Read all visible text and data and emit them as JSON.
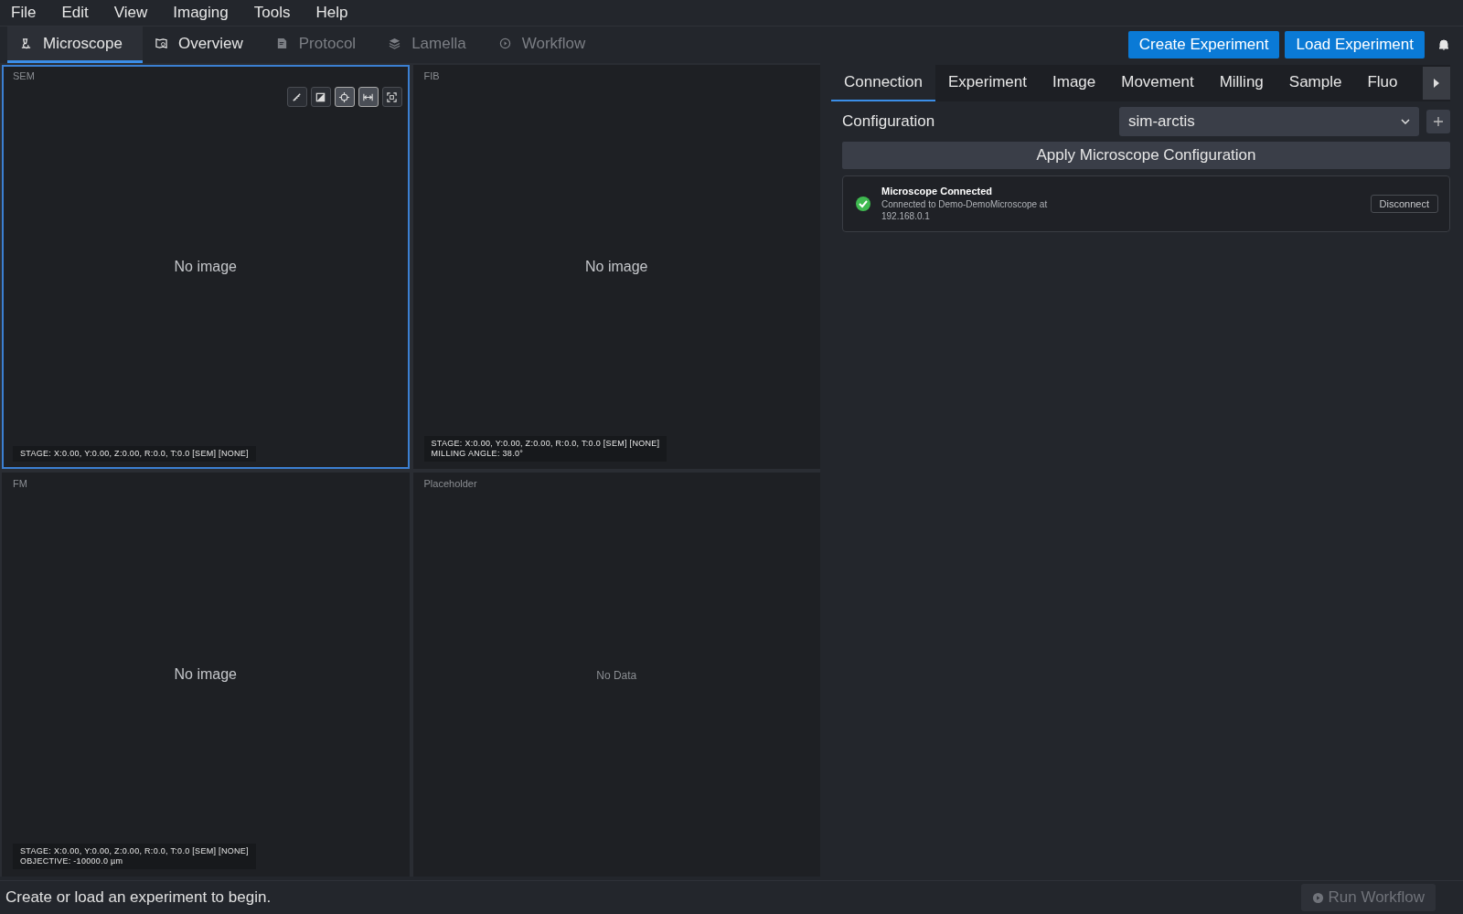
{
  "menu_bar": [
    "File",
    "Edit",
    "View",
    "Imaging",
    "Tools",
    "Help"
  ],
  "main_tabs": [
    {
      "label": "Microscope",
      "selected": true,
      "disabled": false
    },
    {
      "label": "Overview",
      "selected": false,
      "disabled": false
    },
    {
      "label": "Protocol",
      "selected": false,
      "disabled": true
    },
    {
      "label": "Lamella",
      "selected": false,
      "disabled": true
    },
    {
      "label": "Workflow",
      "selected": false,
      "disabled": true
    }
  ],
  "header_buttons": [
    "Create Experiment",
    "Load Experiment"
  ],
  "viewers": [
    {
      "title": "SEM",
      "active": true,
      "message": "No image",
      "toolbar": [
        {
          "on": false
        },
        {
          "on": false
        },
        {
          "on": true
        },
        {
          "on": true
        },
        {
          "on": false
        }
      ],
      "info": [
        "STAGE: X:0.00, Y:0.00, Z:0.00, R:0.0, T:0.0 [SEM] [NONE]"
      ]
    },
    {
      "title": "FIB",
      "active": false,
      "message": "No image",
      "info": [
        "STAGE: X:0.00, Y:0.00, Z:0.00, R:0.0, T:0.0 [SEM] [NONE]",
        "MILLING ANGLE: 38.0°"
      ]
    },
    {
      "title": "FM",
      "active": false,
      "message": "No image",
      "info": [
        "STAGE: X:0.00, Y:0.00, Z:0.00, R:0.0, T:0.0 [SEM] [NONE]",
        "OBJECTIVE: -10000.0 µm"
      ]
    },
    {
      "title": "Placeholder",
      "active": false,
      "message": "No Data"
    }
  ],
  "side_tabs": [
    {
      "label": "Connection",
      "selected": true
    },
    {
      "label": "Experiment",
      "selected": false
    },
    {
      "label": "Image",
      "selected": false
    },
    {
      "label": "Movement",
      "selected": false
    },
    {
      "label": "Milling",
      "selected": false
    },
    {
      "label": "Sample",
      "selected": false
    },
    {
      "label": "Fluo",
      "selected": false
    }
  ],
  "configuration": {
    "label": "Configuration",
    "value": "sim-arctis",
    "apply_button": "Apply Microscope Configuration"
  },
  "connection_card": {
    "title": "Microscope Connected",
    "detail": "Connected to Demo-DemoMicroscope at 192.168.0.1",
    "connected": true,
    "button": "Disconnect"
  },
  "status_bar": {
    "message": "Create or load an experiment to begin.",
    "run_button": "Run Workflow",
    "run_disabled": true
  }
}
